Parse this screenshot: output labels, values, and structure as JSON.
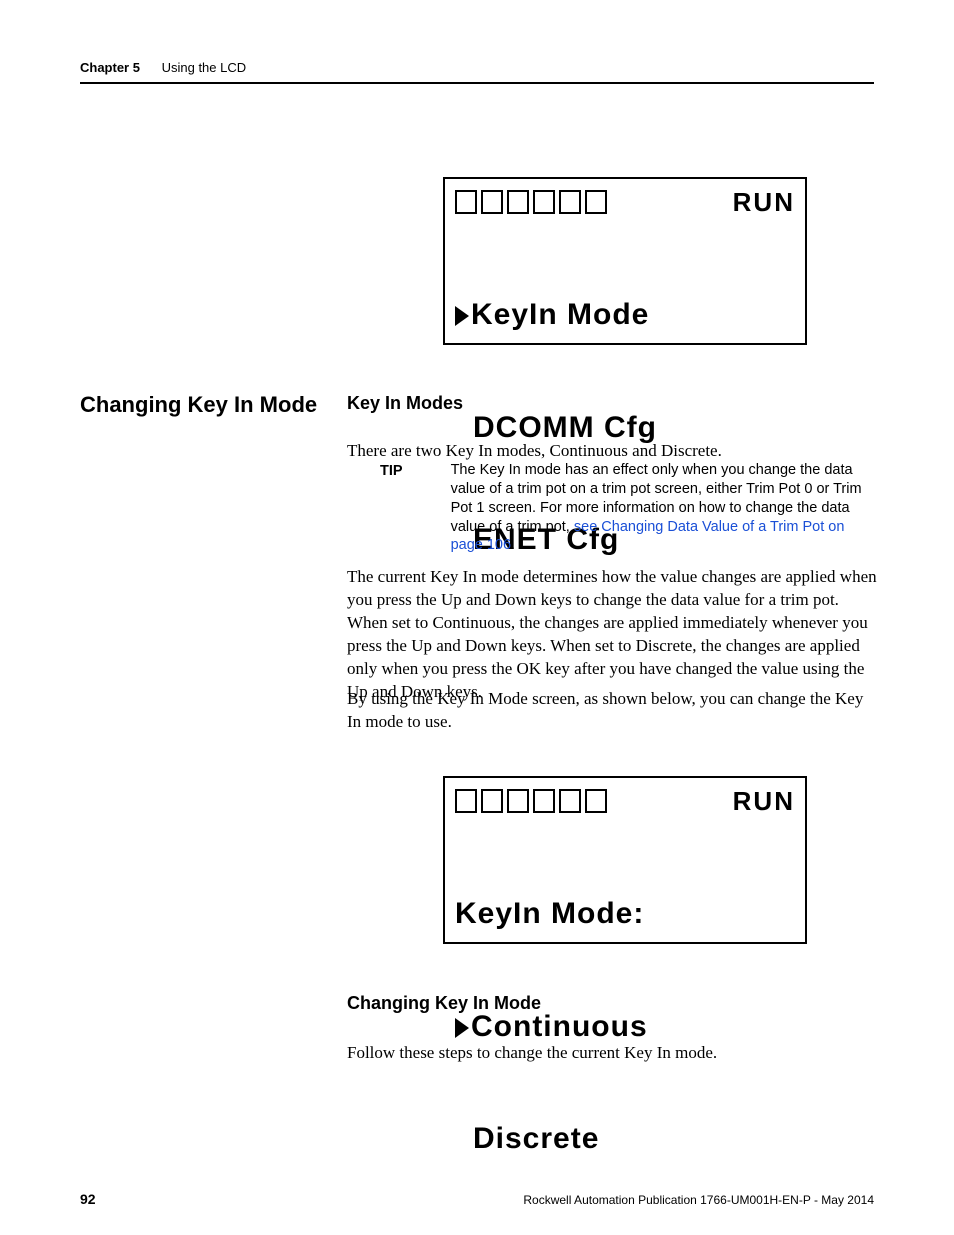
{
  "header": {
    "chapter": "Chapter 5",
    "title": "Using the LCD"
  },
  "lcd1": {
    "status": "RUN",
    "line1": "KeyIn Mode",
    "line2": "DCOMM Cfg",
    "line3": "ENET Cfg"
  },
  "margin_heading": "Changing Key In Mode",
  "subhead1": "Key In Modes",
  "para1": "There are two Key In modes, Continuous and Discrete.",
  "tip": {
    "label": "TIP",
    "text_before_link": "The Key In mode has an effect only when you change the data value of a trim pot on a trim pot screen, either Trim Pot 0 or Trim Pot 1 screen. For more information on how to change the data value of a trim pot, ",
    "link_text": "see  Changing Data Value of a Trim Pot on page 106",
    "text_after_link": "."
  },
  "para2": "The current Key In mode determines how the value changes are applied when you press the Up and Down keys to change the data value for a trim pot. When set to Continuous, the changes are applied immediately whenever you press the Up and Down keys. When set to Discrete, the changes are applied only when you press the OK key after you have changed the value using the Up and Down keys.",
  "para3": "By using the Key In Mode screen, as shown below, you can change the Key In mode to use.",
  "lcd2": {
    "status": "RUN",
    "line1": "KeyIn Mode:",
    "line2": "Continuous",
    "line3": "Discrete"
  },
  "subhead2": "Changing Key In Mode",
  "para4": "Follow these steps to change the current Key In mode.",
  "footer": {
    "page": "92",
    "pub": "Rockwell Automation Publication 1766-UM001H-EN-P - May 2014"
  }
}
